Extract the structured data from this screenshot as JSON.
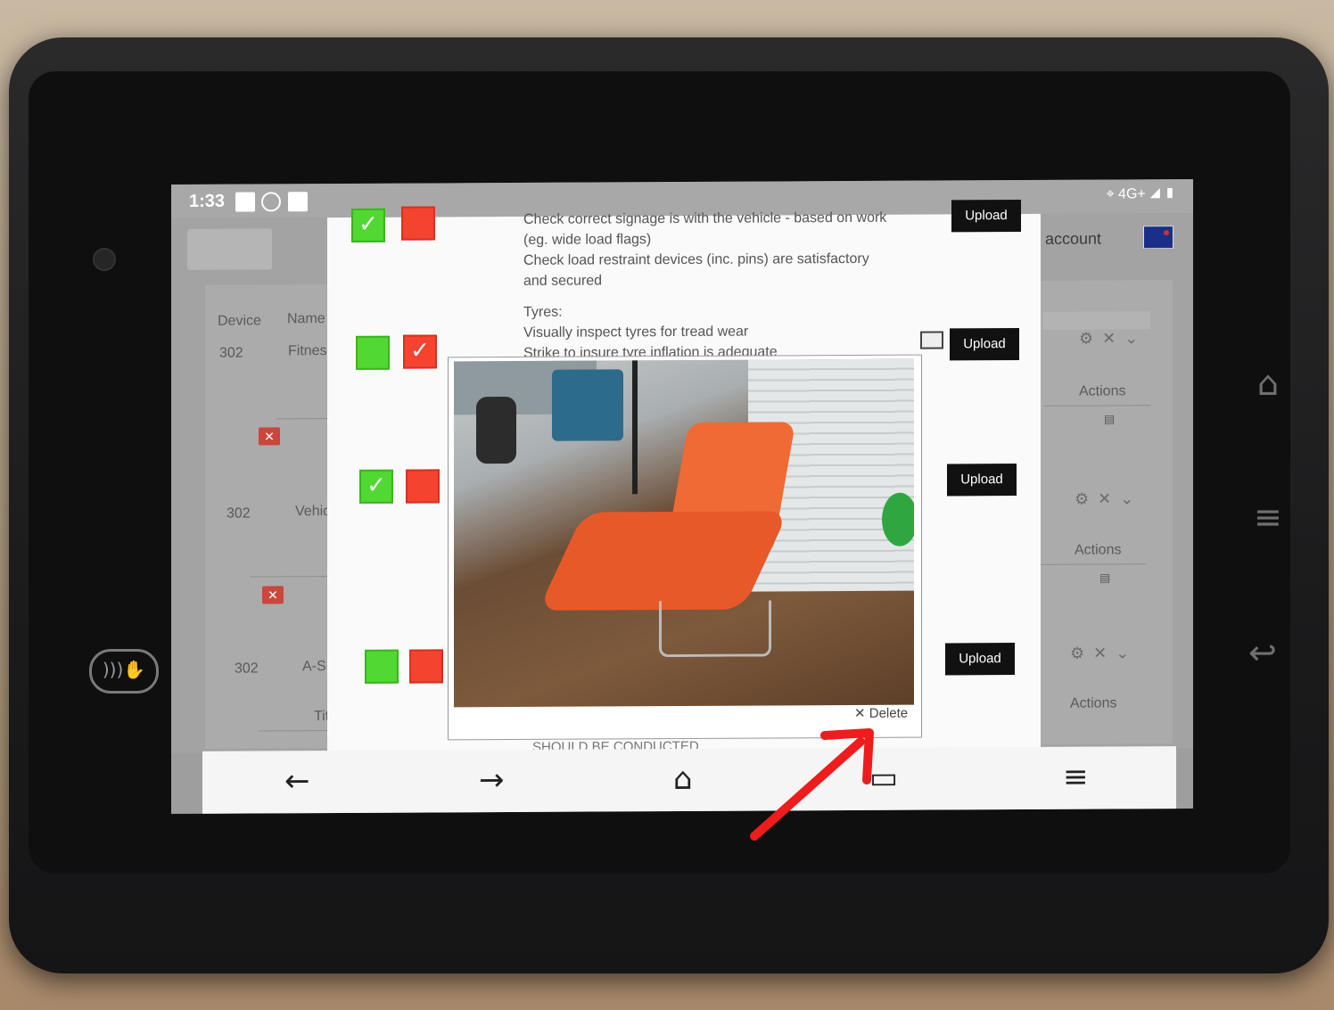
{
  "status_bar": {
    "time": "1:33",
    "network": "4G+"
  },
  "header": {
    "account_label": "account"
  },
  "background_table": {
    "columns": [
      "Device",
      "Name"
    ],
    "rows": [
      {
        "device": "302",
        "name": "Fitnes"
      },
      {
        "device": "302",
        "name": "Vehicl"
      },
      {
        "device": "302",
        "name": "A-SER"
      }
    ],
    "title_label": "Title",
    "actions_label": "Actions"
  },
  "modal": {
    "items": [
      {
        "lines": [
          "Check correct signage is with the vehicle - based on work",
          "(eg. wide load flags)",
          "Check load restraint devices (inc. pins) are satisfactory",
          "and secured"
        ],
        "upload_label": "Upload"
      },
      {
        "lines": [
          "Tyres:",
          "Visually inspect tyres for tread wear",
          "Strike to insure tyre inflation is adequate"
        ],
        "upload_label": "Upload"
      },
      {
        "upload_label": "Upload"
      },
      {
        "upload_label": "Upload"
      }
    ],
    "delete_label": "✕ Delete",
    "bottom_text": "SHOULD BE CONDUCTED"
  },
  "navbar": {
    "back": "←",
    "forward": "→",
    "home": "⌂",
    "tabs": "▭",
    "menu": "≡"
  },
  "colors": {
    "pass_green": "#51d832",
    "fail_red": "#f4432f",
    "upload_button": "#111111",
    "annotation_arrow": "#ee1c1c"
  }
}
